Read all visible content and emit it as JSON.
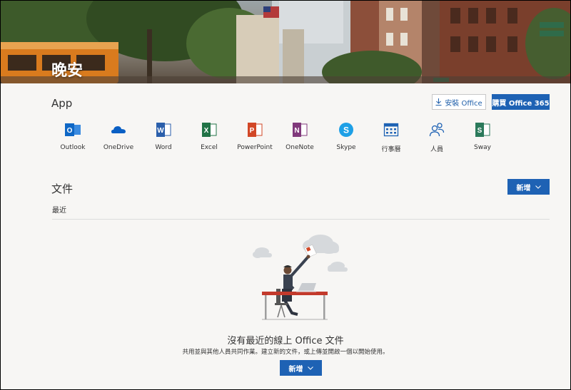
{
  "header": {
    "greeting": "晚安"
  },
  "apps_section": {
    "title": "App",
    "install_label": "安裝 Office",
    "buy_label": "購買 Office 365",
    "apps": [
      {
        "label": "Outlook",
        "icon": "outlook-icon",
        "color": "#0f67c5"
      },
      {
        "label": "OneDrive",
        "icon": "onedrive-icon",
        "color": "#0a5fc4"
      },
      {
        "label": "Word",
        "icon": "word-icon",
        "color": "#2b5fab"
      },
      {
        "label": "Excel",
        "icon": "excel-icon",
        "color": "#217346"
      },
      {
        "label": "PowerPoint",
        "icon": "powerpoint-icon",
        "color": "#d24726"
      },
      {
        "label": "OneNote",
        "icon": "onenote-icon",
        "color": "#80397b"
      },
      {
        "label": "Skype",
        "icon": "skype-icon",
        "color": "#1ea0e6"
      },
      {
        "label": "行事曆",
        "icon": "calendar-icon",
        "color": "#1e62b4"
      },
      {
        "label": "人員",
        "icon": "people-icon",
        "color": "#1e62b4"
      },
      {
        "label": "Sway",
        "icon": "sway-icon",
        "color": "#2b7a5b"
      }
    ]
  },
  "documents_section": {
    "title": "文件",
    "new_label": "新增",
    "recent_label": "最近",
    "empty_title": "沒有最近的線上 Office 文件",
    "empty_subtitle": "共用並與其他人員共同作業。建立新的文件，或上傳並開啟一個以開始使用。",
    "empty_new_label": "新增"
  },
  "colors": {
    "accent": "#1e62b4",
    "background": "#f7f6f4"
  }
}
